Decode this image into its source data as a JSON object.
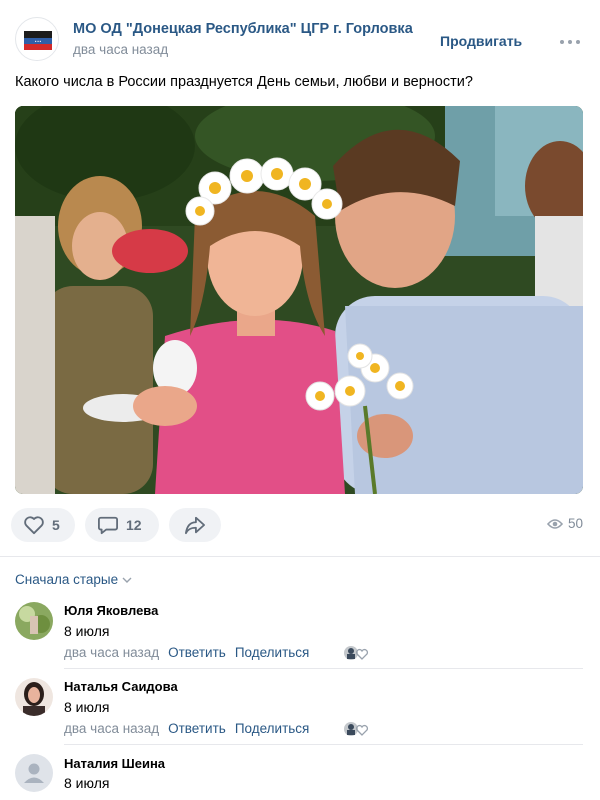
{
  "post": {
    "group_name": "МО ОД \"Донецкая Республика\" ЦГР г. Горловка",
    "time": "два часа назад",
    "promote_label": "Продвигать",
    "text": "Какого числа в России празднуется День семьи, любви и верности?",
    "photo_icon": "couple-with-daisy-wreath-photo"
  },
  "actions": {
    "likes": "5",
    "comments": "12",
    "views": "50"
  },
  "sort_label": "Сначала старые",
  "comments": [
    {
      "author": "Юля Яковлева",
      "text": "8 июля",
      "time": "два часа назад",
      "reply": "Ответить",
      "share": "Поделиться"
    },
    {
      "author": "Наталья Саидова",
      "text": "8 июля",
      "time": "два часа назад",
      "reply": "Ответить",
      "share": "Поделиться"
    },
    {
      "author": "Наталия Шеина",
      "text": "8 июля",
      "time": "",
      "reply": "",
      "share": ""
    }
  ],
  "colors": {
    "link": "#2a5885",
    "secondary": "#818c99",
    "button_bg": "#f0f2f5"
  }
}
